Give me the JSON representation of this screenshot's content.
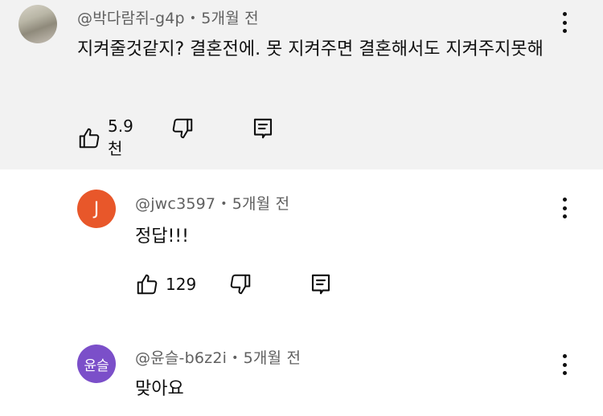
{
  "comments": [
    {
      "author": "@박다람쥐-g4p",
      "time": "5개월 전",
      "text": "지켜줄것같지? 결혼전에. 못 지켜주면 결혼해서도 지켜주지못해",
      "likes": "5.9천",
      "avatar_text": ""
    },
    {
      "author": "@jwc3597",
      "time": "5개월 전",
      "text": "정답!!!",
      "likes": "129",
      "avatar_text": "J",
      "avatar_color": "#e8572a"
    },
    {
      "author": "@윤슬-b6z2i",
      "time": "5개월 전",
      "text": "맞아요",
      "avatar_text": "윤슬",
      "avatar_color": "#7b4fc9"
    }
  ],
  "separator": "•"
}
